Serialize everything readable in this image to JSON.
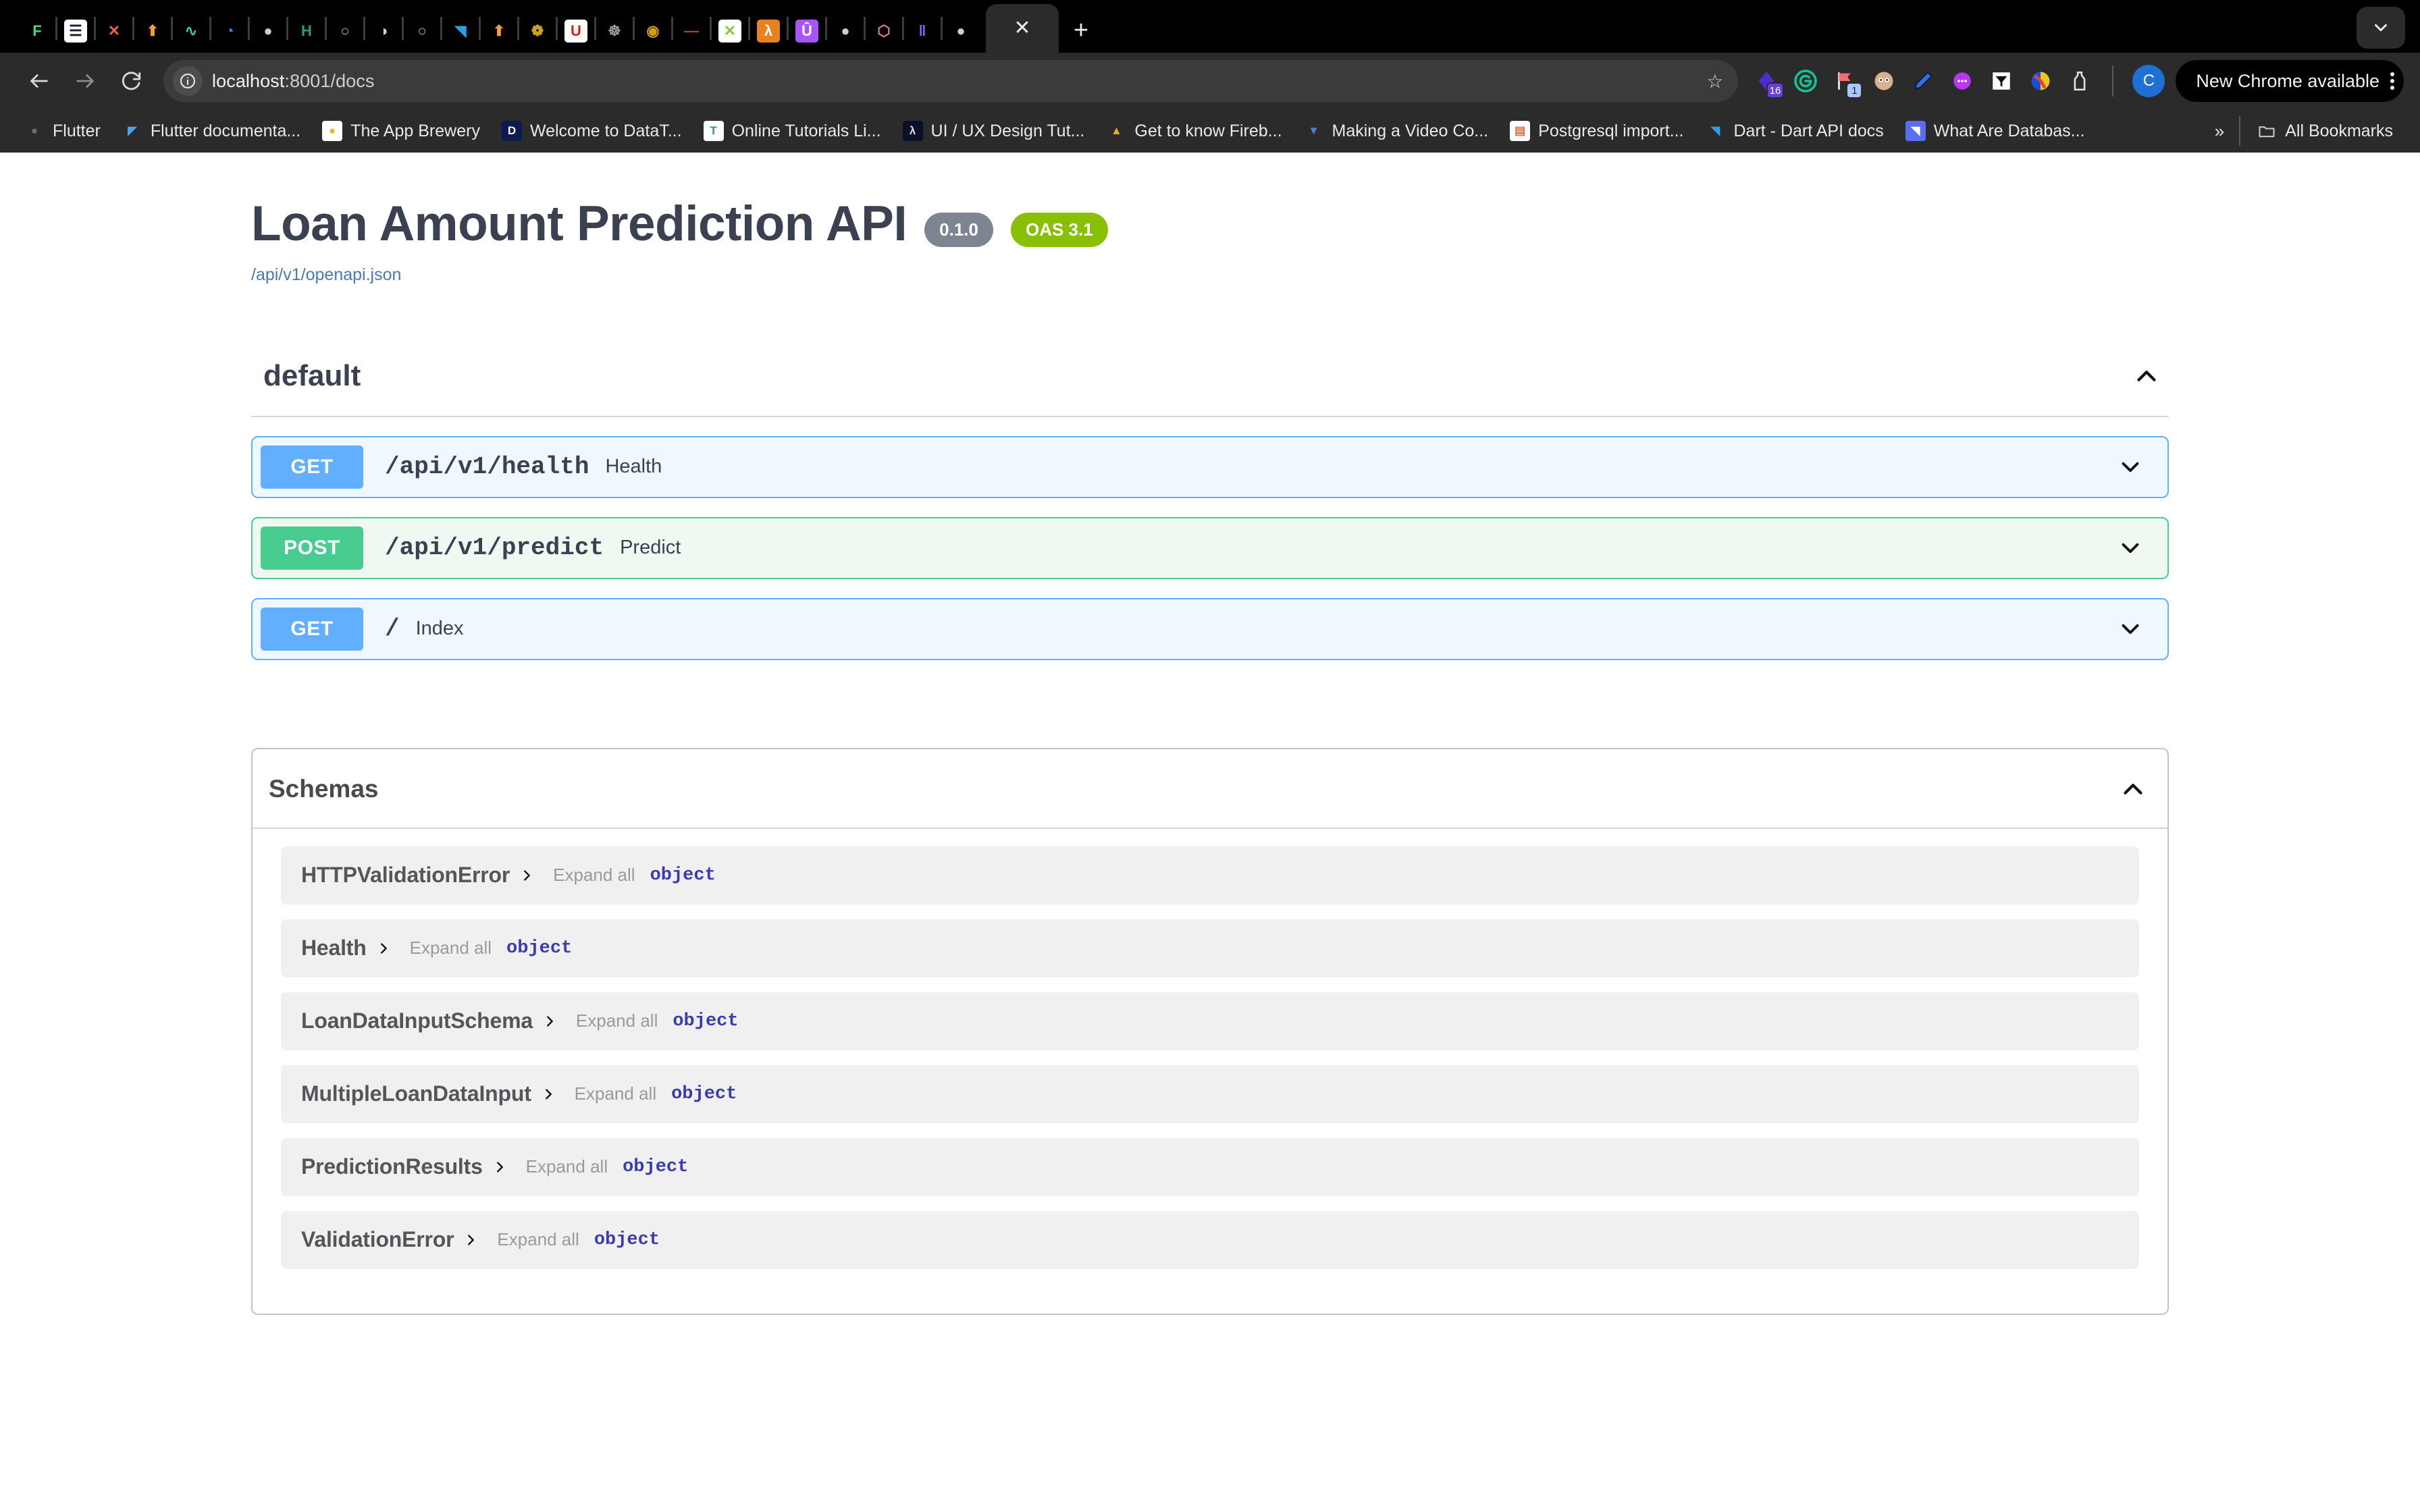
{
  "browser": {
    "url_host": "localhost",
    "url_path": ":8001/docs",
    "update_label": "New Chrome available",
    "profile_initial": "C",
    "all_bookmarks_label": "All Bookmarks",
    "ext_badges": {
      "first": "16",
      "second": "1"
    },
    "tabs": [
      {
        "name": "flutter-tab",
        "glyph": "F",
        "bg": "#000000",
        "color": "#3ddc84"
      },
      {
        "name": "docs-tab",
        "glyph": "☰",
        "bg": "#ffffff",
        "color": "#1a1a2e"
      },
      {
        "name": "x-tab",
        "glyph": "✕",
        "bg": "#000000",
        "color": "#e8604c"
      },
      {
        "name": "arrow-tab",
        "glyph": "⬆",
        "bg": "#000000",
        "color": "#f5a02a"
      },
      {
        "name": "supabase-tab",
        "glyph": "∿",
        "bg": "#000000",
        "color": "#3ecf8e"
      },
      {
        "name": "google-cloud-tab",
        "glyph": "◔",
        "bg": "#000000",
        "color": "#4285f4"
      },
      {
        "name": "github-tab",
        "glyph": "●",
        "bg": "#000000",
        "color": "#cccccc"
      },
      {
        "name": "hi-tab",
        "glyph": "H",
        "bg": "#000000",
        "color": "#2e9e6b"
      },
      {
        "name": "generic-tab-1",
        "glyph": "○",
        "bg": "#000000",
        "color": "#bdbdbd"
      },
      {
        "name": "generic-tab-2",
        "glyph": "◑",
        "bg": "#000000",
        "color": "#cfcfcf"
      },
      {
        "name": "generic-tab-3",
        "glyph": "○",
        "bg": "#000000",
        "color": "#bdbdbd"
      },
      {
        "name": "blue-shape-tab",
        "glyph": "◥",
        "bg": "#000000",
        "color": "#2b9fe0"
      },
      {
        "name": "orange-arrow-tab",
        "glyph": "⬆",
        "bg": "#000000",
        "color": "#f5a02a"
      },
      {
        "name": "emblem-tab",
        "glyph": "❁",
        "bg": "#000000",
        "color": "#c9a227"
      },
      {
        "name": "udi-tab",
        "glyph": "U",
        "bg": "#ffffff",
        "color": "#cc2222"
      },
      {
        "name": "seal-tab",
        "glyph": "☸",
        "bg": "#000000",
        "color": "#9a9a9a"
      },
      {
        "name": "gold-seal-tab",
        "glyph": "◉",
        "bg": "#000000",
        "color": "#d4a017"
      },
      {
        "name": "red-text-tab",
        "glyph": "—",
        "bg": "#000000",
        "color": "#cc3333"
      },
      {
        "name": "xing-tab",
        "glyph": "✕",
        "bg": "#ffffff",
        "color": "#8ec63f"
      },
      {
        "name": "aws-lambda-tab",
        "glyph": "λ",
        "bg": "#e8821e",
        "color": "#ffffff"
      },
      {
        "name": "purple-u-tab",
        "glyph": "Û",
        "bg": "#a855f7",
        "color": "#ffffff"
      },
      {
        "name": "github-tab-2",
        "glyph": "●",
        "bg": "#000000",
        "color": "#cfcfcf"
      },
      {
        "name": "cube-tab",
        "glyph": "⬡",
        "bg": "#000000",
        "color": "#e879c0"
      },
      {
        "name": "code-tab",
        "glyph": "‖",
        "bg": "#000000",
        "color": "#7b6cf6"
      },
      {
        "name": "github-tab-3",
        "glyph": "●",
        "bg": "#000000",
        "color": "#cfcfcf"
      }
    ],
    "bookmarks": [
      {
        "label": "Flutter",
        "glyph": "●",
        "bg": "#2b2b2b",
        "color": "#6b6b6b"
      },
      {
        "label": "Flutter documenta...",
        "glyph": "◤",
        "bg": "#2b2b2b",
        "color": "#42a5f5"
      },
      {
        "label": "The App Brewery",
        "glyph": "●",
        "bg": "#ffffff",
        "color": "#f0b429"
      },
      {
        "label": "Welcome to DataT...",
        "glyph": "D",
        "bg": "#0b1b4f",
        "color": "#ffffff"
      },
      {
        "label": "Online Tutorials Li...",
        "glyph": "T",
        "bg": "#ffffff",
        "color": "#2e9e5b"
      },
      {
        "label": "UI / UX Design Tut...",
        "glyph": "λ",
        "bg": "#0b1029",
        "color": "#dddddd"
      },
      {
        "label": "Get to know Fireb...",
        "glyph": "▲",
        "bg": "#2b2b2b",
        "color": "#f5a623"
      },
      {
        "label": "Making a Video Co...",
        "glyph": "▼",
        "bg": "#2b2b2b",
        "color": "#4a7ddb"
      },
      {
        "label": "Postgresql import...",
        "glyph": "▤",
        "bg": "#ffffff",
        "color": "#d96b3c"
      },
      {
        "label": "Dart - Dart API docs",
        "glyph": "◥",
        "bg": "#2b2b2b",
        "color": "#2b9fe0"
      },
      {
        "label": "What Are Databas...",
        "glyph": "◥",
        "bg": "#5a6ff0",
        "color": "#ffffff"
      }
    ]
  },
  "swagger": {
    "title": "Loan Amount Prediction API",
    "version_badge": "0.1.0",
    "oas_badge": "OAS 3.1",
    "spec_url": "/api/v1/openapi.json",
    "tag": {
      "name": "default",
      "operations": [
        {
          "method": "GET",
          "path": "/api/v1/health",
          "summary": "Health",
          "style": "get"
        },
        {
          "method": "POST",
          "path": "/api/v1/predict",
          "summary": "Predict",
          "style": "post"
        },
        {
          "method": "GET",
          "path": "/",
          "summary": "Index",
          "style": "get"
        }
      ]
    },
    "models": {
      "title": "Schemas",
      "expand_all_label": "Expand all",
      "type_label": "object",
      "items": [
        {
          "name": "HTTPValidationError"
        },
        {
          "name": "Health"
        },
        {
          "name": "LoanDataInputSchema"
        },
        {
          "name": "MultipleLoanDataInput"
        },
        {
          "name": "PredictionResults"
        },
        {
          "name": "ValidationError"
        }
      ]
    }
  },
  "colors": {
    "get": "#61affe",
    "post": "#49cc90",
    "oas_green": "#89bf04",
    "version_gray": "#7d8492",
    "heading": "#3b4151",
    "link": "#4a78b5"
  }
}
